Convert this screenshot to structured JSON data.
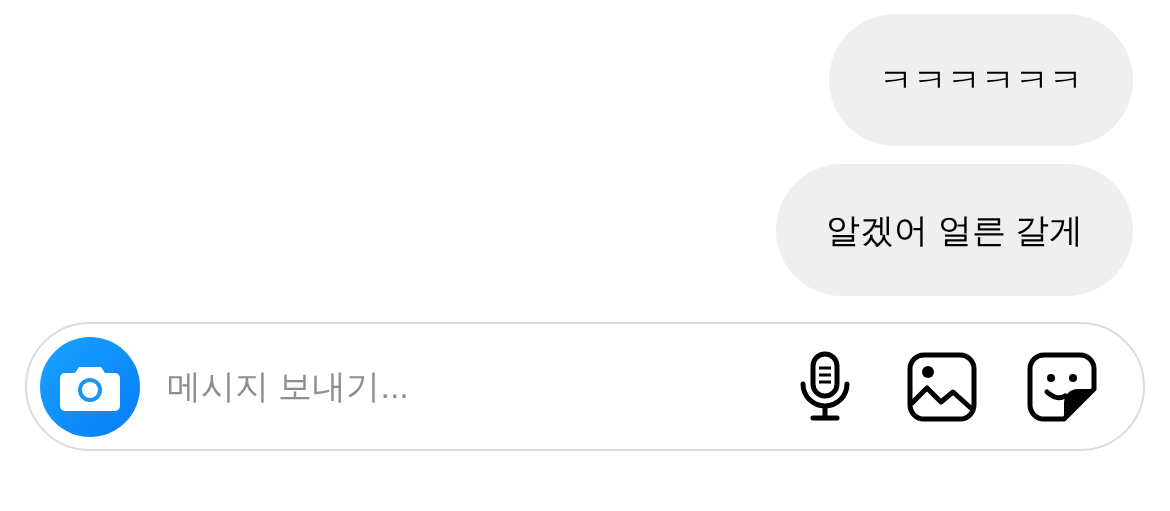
{
  "messages": [
    {
      "text": "ㅋㅋㅋㅋㅋㅋ",
      "outgoing": true
    },
    {
      "text": "알겠어 얼른 갈게",
      "outgoing": true
    }
  ],
  "composer": {
    "placeholder": "메시지 보내기..."
  }
}
